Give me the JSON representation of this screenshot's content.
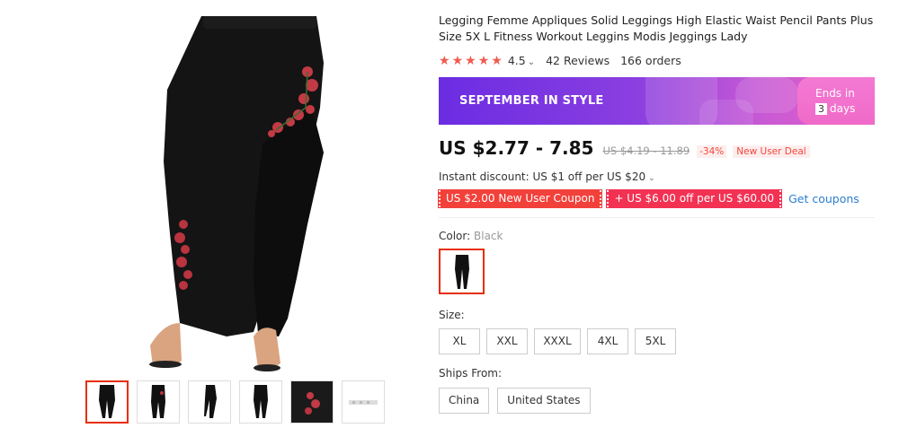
{
  "product": {
    "title": "Legging Femme Appliques Solid Leggings High Elastic Waist Pencil Pants Plus Size 5X L Fitness Workout Leggins Modis Jeggings Lady",
    "rating": "4.5",
    "reviews": "42 Reviews",
    "orders": "166 orders"
  },
  "promo": {
    "text": "SEPTEMBER IN STYLE",
    "ends_label": "Ends in",
    "days_num": "3",
    "days_label": "days"
  },
  "price": {
    "current": "US $2.77 - 7.85",
    "original": "US $4.19 - 11.89",
    "discount": "-34%",
    "deal": "New User Deal"
  },
  "instant_discount": "Instant discount: US $1 off per US $20",
  "coupons": {
    "coupon1": "US $2.00 New User Coupon",
    "coupon2": "+ US $6.00 off per US $60.00",
    "get": "Get coupons"
  },
  "color": {
    "label": "Color:",
    "value": "Black"
  },
  "size": {
    "label": "Size:",
    "options": [
      "XL",
      "XXL",
      "XXXL",
      "4XL",
      "5XL"
    ]
  },
  "ships": {
    "label": "Ships From:",
    "options": [
      "China",
      "United States"
    ]
  },
  "icons": {
    "star": "star-icon",
    "chevron": "chevron-down-icon"
  },
  "colors": {
    "accent": "#e62e04",
    "star": "#f05a4f",
    "link": "#2b7ecf"
  }
}
